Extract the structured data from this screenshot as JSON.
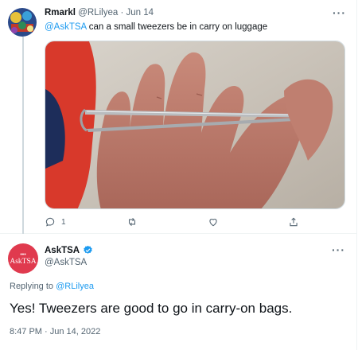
{
  "tweet1": {
    "display_name": "Rmarkl",
    "handle": "@RLilyea",
    "separator": "·",
    "date": "Jun 14",
    "mention": "@AskTSA",
    "text": " can a small tweezers be in carry on luggage",
    "media_icon": "photo-of-tweezers-in-hand",
    "more_icon": "more-icon",
    "actions": {
      "reply_count": "1",
      "reply_icon": "reply-icon",
      "retweet_icon": "retweet-icon",
      "like_icon": "like-icon",
      "share_icon": "share-icon"
    }
  },
  "tweet2": {
    "display_name": "AskTSA",
    "handle": "@AskTSA",
    "avatar_text": "AskTSA",
    "verified_icon": "verified-badge-icon",
    "replying_prefix": "Replying to ",
    "replying_handle": "@RLilyea",
    "text": "Yes! Tweezers are good to go in carry-on bags.",
    "timestamp": "8:47 PM · Jun 14, 2022"
  },
  "colors": {
    "link": "#1d9bf0",
    "secondary_text": "#536471",
    "divider": "#eff3f4",
    "avatar_red": "#e03a4e"
  }
}
